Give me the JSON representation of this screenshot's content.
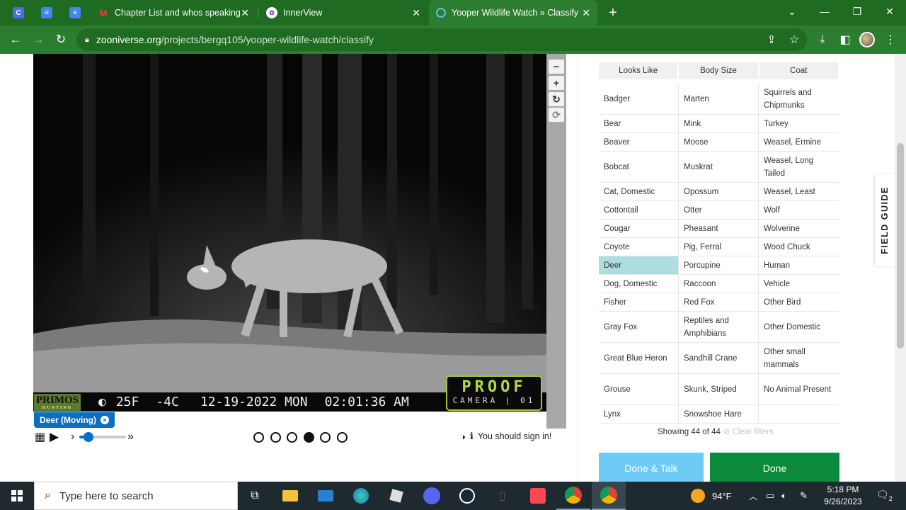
{
  "tabs": [
    {
      "title": "",
      "icon_color": "#4a6df0",
      "icon_letter": "C"
    },
    {
      "title": "",
      "icon_color": "#4285f4",
      "icon_letter": "≡"
    },
    {
      "title": "",
      "icon_color": "#4285f4",
      "icon_letter": "≡"
    },
    {
      "title": "Chapter List and whos speaking",
      "icon_letter": "M",
      "close": "✕"
    },
    {
      "title": "InnerView",
      "close": "✕"
    },
    {
      "title": "Yooper Wildlife Watch » Classify",
      "close": "✕"
    }
  ],
  "new_tab": "+",
  "window_controls": {
    "dropdown": "⌄",
    "minimize": "—",
    "restore": "❐",
    "close": "✕"
  },
  "address_bar": {
    "host": "zooniverse.org",
    "path": "/projects/bergq105/yooper-wildlife-watch/classify"
  },
  "camera_overlay": {
    "brand": "PRIMOS",
    "brand_sub": "HUNTING",
    "moon_icon": "◐",
    "temp_f": "25F",
    "temp_c": "-4C",
    "date": "12-19-2022 MON",
    "time": "02:01:36 AM",
    "logo_top": "PROOF",
    "logo_bottom": "CAMERA | 01"
  },
  "image_tools": {
    "zoom_out": "−",
    "zoom_in": "+",
    "rotate": "↻",
    "reset": "⟳"
  },
  "selected_tag": {
    "label": "Deer (Moving)",
    "remove": "×"
  },
  "frame_controls": {
    "grid_icon": "▦",
    "play_icon": "▶",
    "slow_icon": "›",
    "fast_icon": "»"
  },
  "frame_dots": [
    false,
    false,
    false,
    true,
    false,
    false
  ],
  "signin": {
    "contrast_icon": "◑",
    "info_icon": "ℹ",
    "text": "You should sign in!"
  },
  "filters": [
    "Looks Like",
    "Body Size",
    "Coat"
  ],
  "choices": [
    [
      "Badger",
      "Marten",
      "Squirrels and Chipmunks"
    ],
    [
      "Bear",
      "Mink",
      "Turkey"
    ],
    [
      "Beaver",
      "Moose",
      "Weasel, Ermine"
    ],
    [
      "Bobcat",
      "Muskrat",
      "Weasel, Long Tailed"
    ],
    [
      "Cat, Domestic",
      "Opossum",
      "Weasel, Least"
    ],
    [
      "Cottontail",
      "Otter",
      "Wolf"
    ],
    [
      "Cougar",
      "Pheasant",
      "Wolverine"
    ],
    [
      "Coyote",
      "Pig, Ferral",
      "Wood Chuck"
    ],
    [
      "Deer",
      "Porcupine",
      "Human"
    ],
    [
      "Dog, Domestic",
      "Raccoon",
      "Vehicle"
    ],
    [
      "Fisher",
      "Red Fox",
      "Other Bird"
    ],
    [
      "Gray Fox",
      "Reptiles and Amphibians",
      "Other Domestic"
    ],
    [
      "Great Blue Heron",
      "Sandhill Crane",
      "Other small mammals"
    ],
    [
      "Grouse",
      "Skunk, Striped",
      "No Animal Present"
    ],
    [
      "Lynx",
      "Snowshoe Hare",
      ""
    ]
  ],
  "selected_choice": "Deer",
  "showing": {
    "text": "Showing 44 of 44",
    "clear": "⊘ Clear filters"
  },
  "buttons": {
    "done_talk": "Done & Talk",
    "done": "Done"
  },
  "field_guide": "FIELD GUIDE",
  "taskbar": {
    "search_placeholder": "Type here to search",
    "weather": "94°F",
    "time": "5:18 PM",
    "date": "9/26/2023",
    "notifications": "2"
  }
}
